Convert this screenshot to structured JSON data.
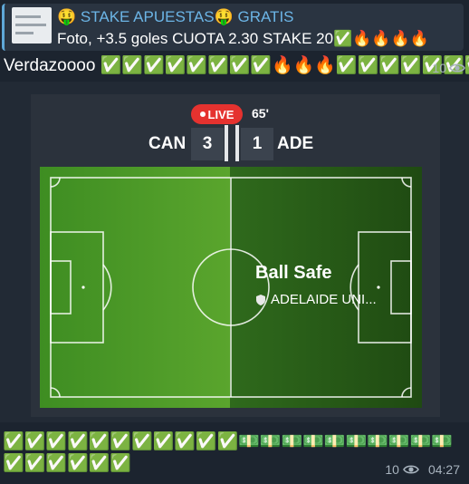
{
  "reply": {
    "title": "🤑 STAKE APUESTAS🤑 GRATIS",
    "text": "Foto, +3.5 goles CUOTA 2.30 STAKE 20✅🔥🔥🔥🔥"
  },
  "message": {
    "text": "Verdazoooo ✅✅✅✅✅✅✅✅🔥🔥🔥✅✅✅✅✅✅✅",
    "views": "10"
  },
  "match": {
    "live_label": "LIVE",
    "minute": "65'",
    "home_team": "CAN",
    "home_score": "3",
    "away_score": "1",
    "away_team": "ADE",
    "event": "Ball Safe",
    "possession_team": "ADELAIDE UNI..."
  },
  "bottom_message": {
    "text": "✅✅✅✅✅✅✅✅✅✅✅💵💵💵💵💵💵💵💵💵💵✅✅✅✅✅✅",
    "views": "10",
    "time": "04:27"
  },
  "colors": {
    "link_blue": "#6cb5e6",
    "live_red": "#e5322f",
    "pitch_green": "#4f9f2a"
  },
  "icons": [
    "eye-icon",
    "shield-icon"
  ]
}
